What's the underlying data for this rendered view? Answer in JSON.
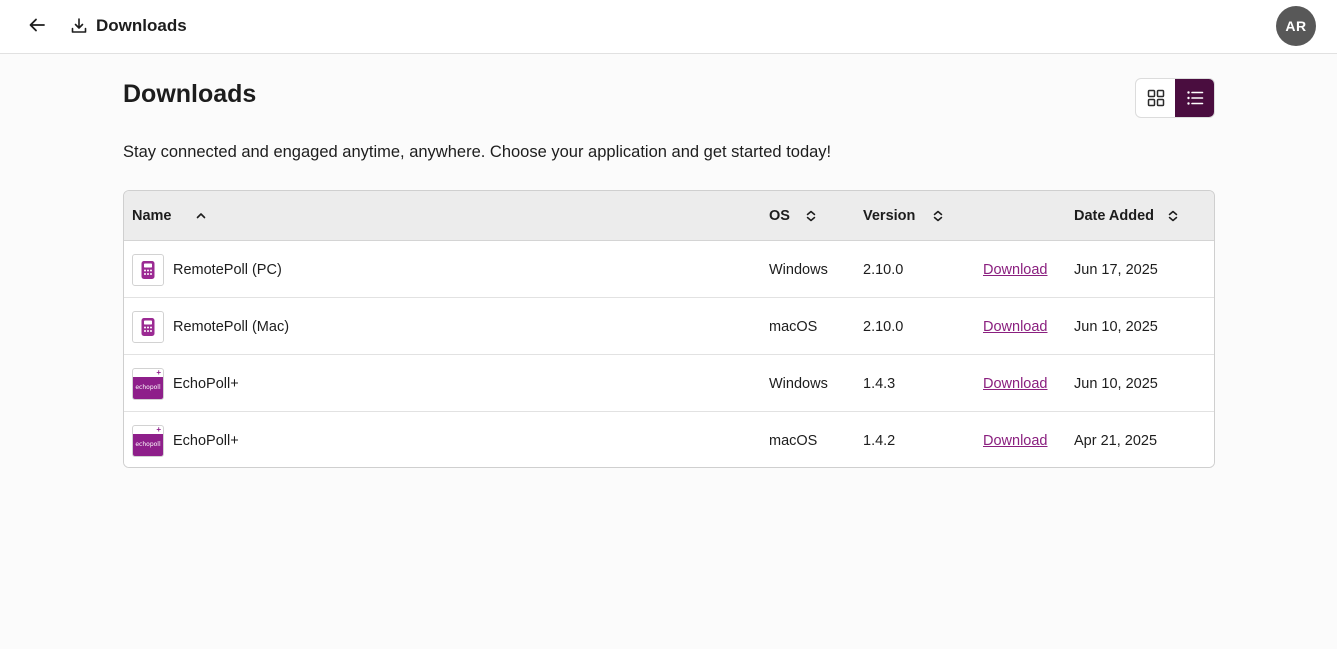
{
  "header": {
    "back_icon": "arrow-left-icon",
    "crumb_icon": "download-tray-icon",
    "crumb_label": "Downloads",
    "avatar_initials": "AR"
  },
  "page": {
    "title": "Downloads",
    "intro": "Stay connected and engaged anytime, anywhere. Choose your application and get started today!",
    "view_toggle": {
      "grid_icon": "grid-icon",
      "list_icon": "list-icon",
      "active": "list"
    }
  },
  "table": {
    "columns": [
      {
        "label": "Name",
        "sort": "ascending"
      },
      {
        "label": "OS",
        "sort": "none"
      },
      {
        "label": "Version",
        "sort": "none"
      },
      {
        "label": "",
        "sort": "none"
      },
      {
        "label": "Date Added",
        "sort": "none"
      }
    ],
    "rows": [
      {
        "name": "RemotePoll (PC)",
        "icon": "remotepoll-icon",
        "os": "Windows",
        "version": "2.10.0",
        "action": "Download",
        "date": "Jun 17, 2025"
      },
      {
        "name": "RemotePoll (Mac)",
        "icon": "remotepoll-icon",
        "os": "macOS",
        "version": "2.10.0",
        "action": "Download",
        "date": "Jun 10, 2025"
      },
      {
        "name": "EchoPoll+",
        "icon": "echopoll-icon",
        "icon_text": "echopoll",
        "os": "Windows",
        "version": "1.4.3",
        "action": "Download",
        "date": "Jun 10, 2025"
      },
      {
        "name": "EchoPoll+",
        "icon": "echopoll-icon",
        "icon_text": "echopoll",
        "os": "macOS",
        "version": "1.4.2",
        "action": "Download",
        "date": "Apr 21, 2025"
      }
    ]
  },
  "colors": {
    "accent": "#8a1f7f",
    "active_toggle": "#4a0d3f",
    "avatar_bg": "#585858"
  }
}
